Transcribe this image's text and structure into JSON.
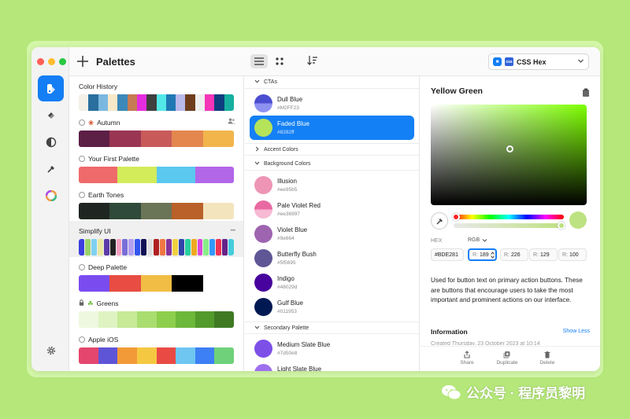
{
  "toolbar": {
    "title": "Palettes",
    "format_label": "CSS Hex",
    "format_badge": "css"
  },
  "palettes": [
    {
      "name": "Color History",
      "has_radio": false,
      "prefix_icon": "",
      "right_icon": "",
      "colors": [
        "#f4f0e8",
        "#2a6f9e",
        "#7bb8e0",
        "#f7e9c8",
        "#3c88b8",
        "#c67a52",
        "#e52ddf",
        "#3f3f3f",
        "#53e8e8",
        "#1f78b4",
        "#b9b9ea",
        "#6f3d1c",
        "#eeeeee",
        "#f535b7",
        "#0f3e7f",
        "#16b0a0"
      ],
      "gap": false
    },
    {
      "name": "Autumn",
      "has_radio": true,
      "prefix_icon": "maple-leaf-icon",
      "right_icon": "people-icon",
      "colors": [
        "#5c1f46",
        "#9a3553",
        "#c95a5a",
        "#e3874f",
        "#f1b54c"
      ],
      "gap": false
    },
    {
      "name": "Your First Palette",
      "has_radio": true,
      "prefix_icon": "",
      "right_icon": "",
      "colors": [
        "#ef6a6a",
        "#d3ec5a",
        "#5bc8ef",
        "#b266e8"
      ],
      "gap": false
    },
    {
      "name": "Earth Tones",
      "has_radio": true,
      "prefix_icon": "",
      "right_icon": "",
      "colors": [
        "#1f2621",
        "#2f4a3a",
        "#6a7456",
        "#b96129",
        "#f3e4bd"
      ],
      "gap": false
    },
    {
      "name": "Simplify UI",
      "has_radio": false,
      "prefix_icon": "",
      "right_icon": "more-icon",
      "selected": true,
      "colors": [
        "#3b3ee0",
        "#9ad36a",
        "#7fd0f0",
        "#e8e8a0",
        "#5c3ba8",
        "#222",
        "#f5a0c0",
        "#7a6ed8",
        "#b4a0f0",
        "#3355ee",
        "#111155",
        "#e0e0e0",
        "#b02020",
        "#ee7744",
        "#883399",
        "#f0d040",
        "#3344aa",
        "#2ad0a0",
        "#eeaa22",
        "#d94ad9",
        "#88ee88",
        "#3399ff",
        "#ee3355",
        "#662288",
        "#44ccdd"
      ],
      "gap": true
    },
    {
      "name": "Deep Palette",
      "has_radio": true,
      "prefix_icon": "",
      "right_icon": "",
      "colors": [
        "#7a4cf0",
        "#e84c42",
        "#f1bd44",
        "#000000",
        "#ffffff"
      ],
      "gap": false
    },
    {
      "name": "Greens",
      "has_radio": false,
      "prefix_icon": "lock-icon",
      "prefix_icon2": "leaf-icon",
      "right_icon": "",
      "colors": [
        "#eef8df",
        "#dff3c2",
        "#c6ea96",
        "#aadd70",
        "#8dcf4c",
        "#6cb83a",
        "#539a2c",
        "#3f7a23"
      ],
      "gap": false
    },
    {
      "name": "Apple iOS",
      "has_radio": true,
      "prefix_icon": "",
      "right_icon": "",
      "colors": [
        "#e5466d",
        "#5e55d6",
        "#f29a38",
        "#f5c842",
        "#e94b44",
        "#6ec6f1",
        "#3d7ff5",
        "#6fd17a"
      ],
      "gap": false
    }
  ],
  "groups": {
    "ctas": "CTAs",
    "accent": "Accent Colors",
    "background": "Background Colors",
    "secondary": "Secondary Palette"
  },
  "cta_colors": [
    {
      "name": "Dull Blue",
      "hex": "#M2FF23",
      "color": "#4b4dd0",
      "color2": "#8d91f0",
      "selected": false
    },
    {
      "name": "Faded Blue",
      "hex": "#8282ff",
      "color": "#b5e35a",
      "color2": "#b5e35a",
      "selected": true
    }
  ],
  "background_colors": [
    {
      "name": "Illusion",
      "hex": "#ee95b5",
      "color": "#ee95b5",
      "color2": "#ee95b5"
    },
    {
      "name": "Pale Violet Red",
      "hex": "#ee36997",
      "color": "#e96aa2",
      "color2": "#f7b9d3"
    },
    {
      "name": "Violet Blue",
      "hex": "#9e664",
      "color": "#9e64b0",
      "color2": "#9e64b0"
    },
    {
      "name": "Butterfly Bush",
      "hex": "#5f5695",
      "color": "#5f5695",
      "color2": "#5f5695"
    },
    {
      "name": "Indigo",
      "hex": "#48029d",
      "color": "#48029d",
      "color2": "#48029d"
    },
    {
      "name": "Gulf Blue",
      "hex": "#011953",
      "color": "#011953",
      "color2": "#011953"
    }
  ],
  "secondary_colors": [
    {
      "name": "Medium Slate Blue",
      "hex": "#7d50e8",
      "color": "#7d50e8",
      "color2": "#7d50e8"
    },
    {
      "name": "Light Slate Blue",
      "hex": "",
      "color": "#9d70f0",
      "color2": "#9d70f0"
    }
  ],
  "detail": {
    "title": "Yellow Green",
    "hex_label": "HEX",
    "rgb_label": "RGB",
    "hex_value": "#BDE281",
    "r_key": "R:",
    "r_value": "189",
    "g_key": "R:",
    "g_value": "226",
    "b_key": "R:",
    "b_value": "129",
    "a_key": "R:",
    "a_value": "100",
    "description": "Used for button text on primary action buttons. These are buttons that encourage users to take the most important and prominent actions on our interface.",
    "info_heading": "Information",
    "show_less": "Show Less",
    "info_line": "Created                    Thursday, 23 October 2023 at 10:14",
    "preview_color": "#bde281"
  },
  "actions": {
    "share": "Share",
    "duplicate": "Duplicate",
    "delete": "Delete"
  },
  "watermark": {
    "text": "公众号 · 程序员黎明"
  },
  "colors": {
    "accent": "#147ef5",
    "background": "#b5e77a"
  }
}
